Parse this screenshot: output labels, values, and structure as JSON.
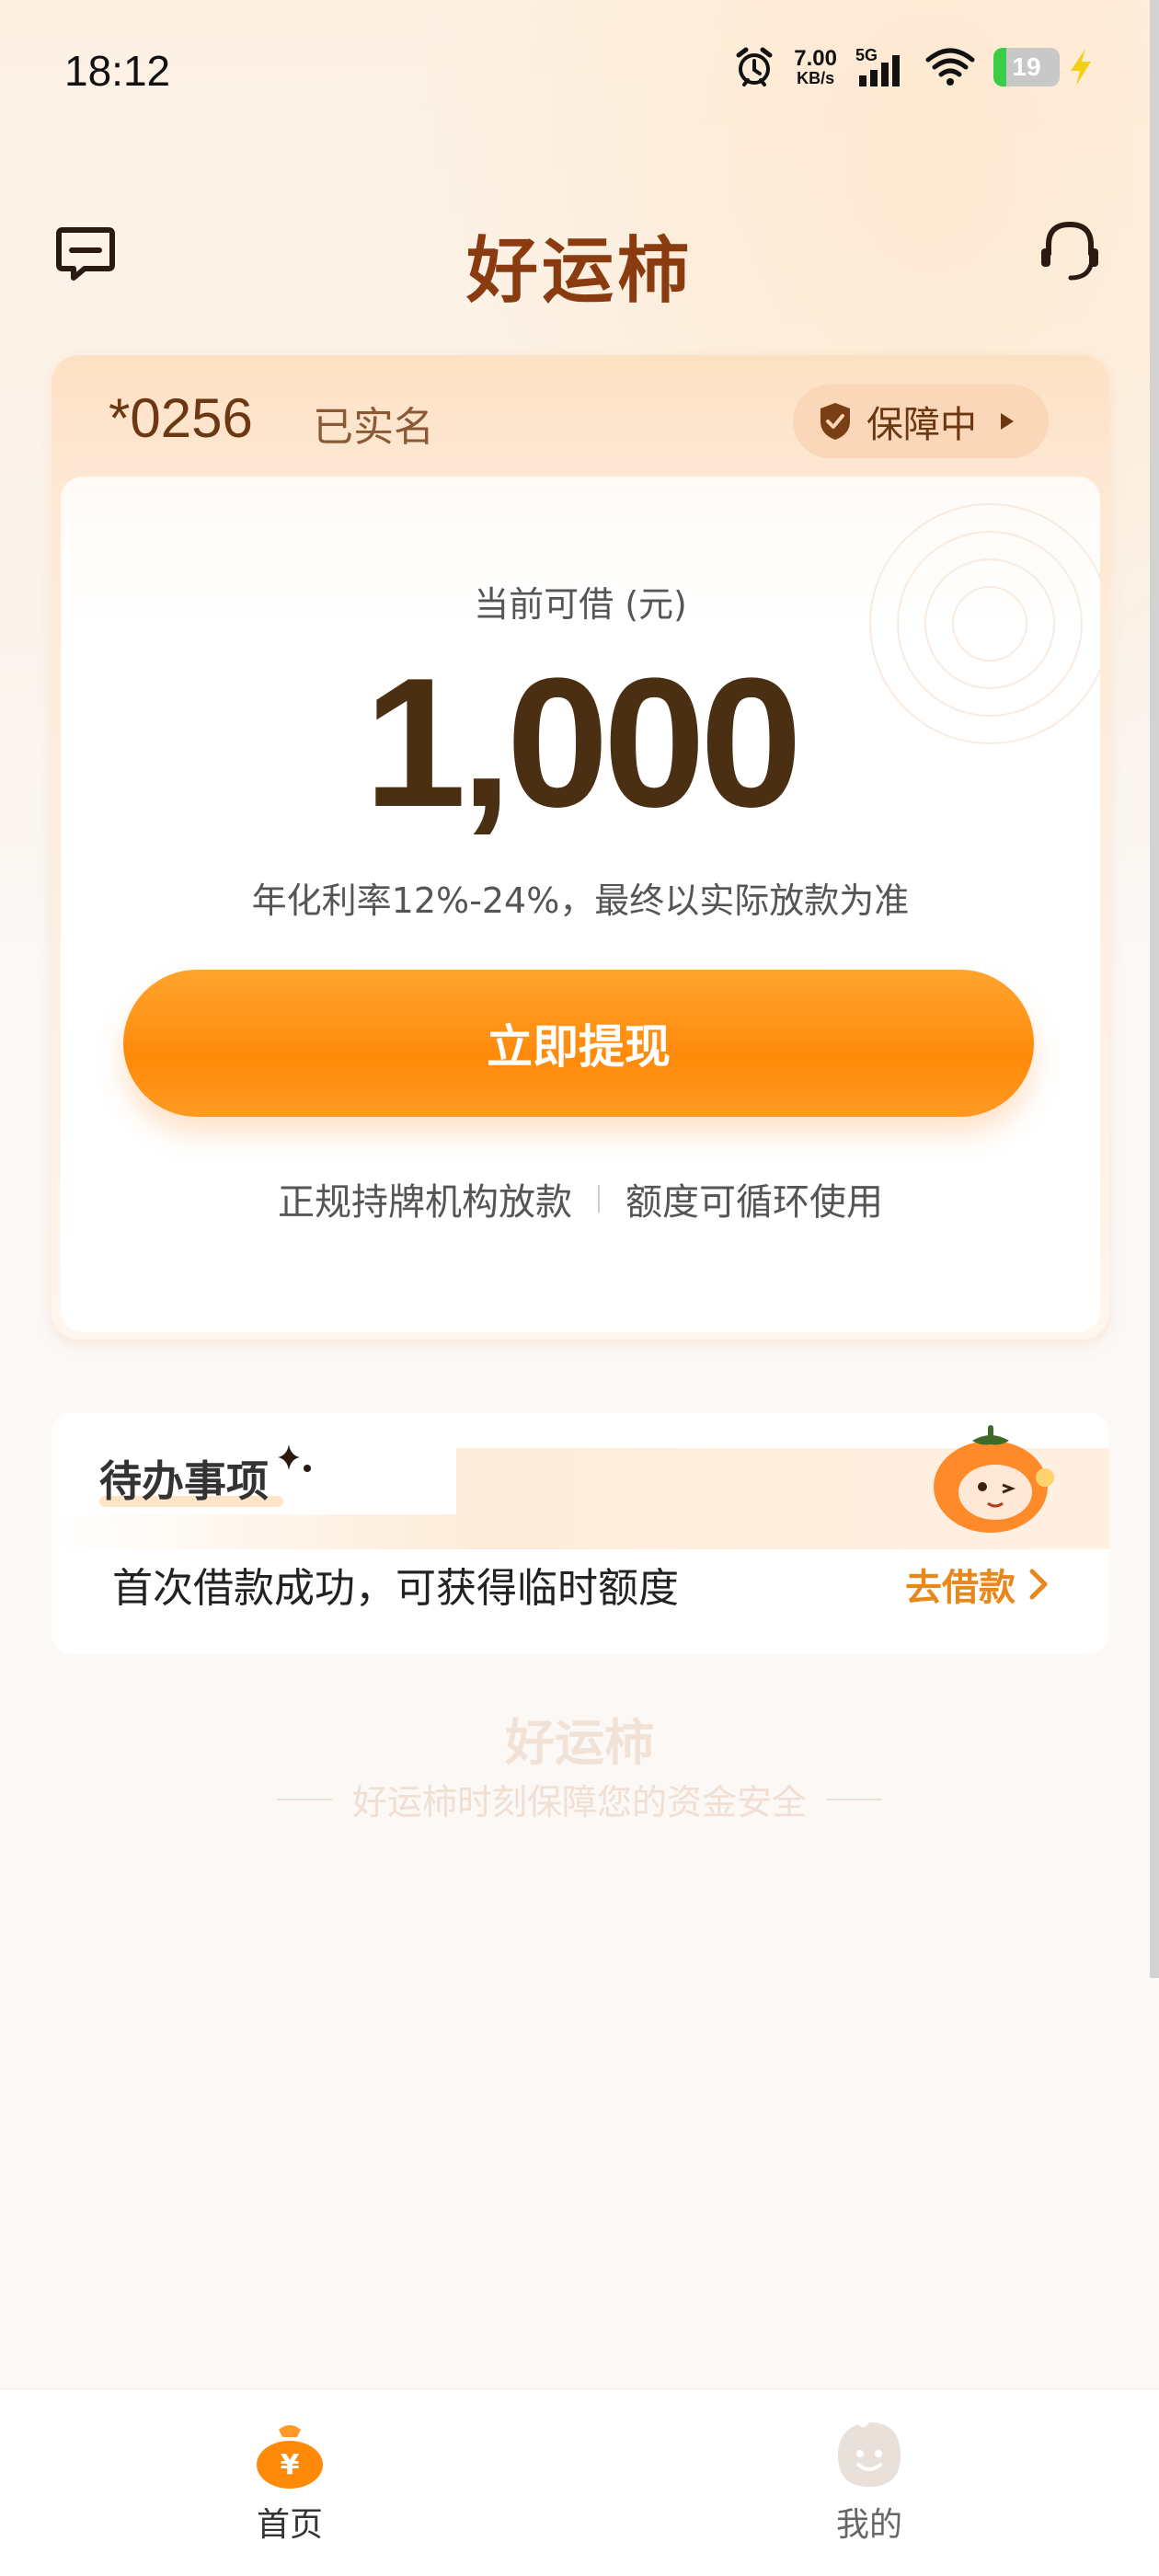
{
  "status_bar": {
    "time": "18:12",
    "net_speed_value": "7.00",
    "net_speed_unit": "KB/s",
    "network_type": "5G",
    "battery_level": "19"
  },
  "header": {
    "title": "好运柿",
    "left_icon": "message-icon",
    "right_icon": "headset-icon"
  },
  "account": {
    "number": "*0256",
    "verification_status": "已实名",
    "guarantee_label": "保障中"
  },
  "credit": {
    "label": "当前可借 (元)",
    "amount": "1,000",
    "rate_note": "年化利率12%-24%，最终以实际放款为准",
    "button_label": "立即提现",
    "features": [
      "正规持牌机构放款",
      "额度可循环使用"
    ]
  },
  "todo": {
    "title": "待办事项",
    "item_text": "首次借款成功，可获得临时额度",
    "action_label": "去借款"
  },
  "footer_watermark": {
    "title": "好运柿",
    "subtitle": "好运柿时刻保障您的资金安全"
  },
  "tabs": [
    {
      "label": "首页",
      "icon": "money-bag-icon",
      "active": true
    },
    {
      "label": "我的",
      "icon": "smiley-icon",
      "active": false
    }
  ],
  "colors": {
    "accent": "#ff8a0a",
    "title_brown": "#8a3c10",
    "link_orange": "#e8871b"
  }
}
